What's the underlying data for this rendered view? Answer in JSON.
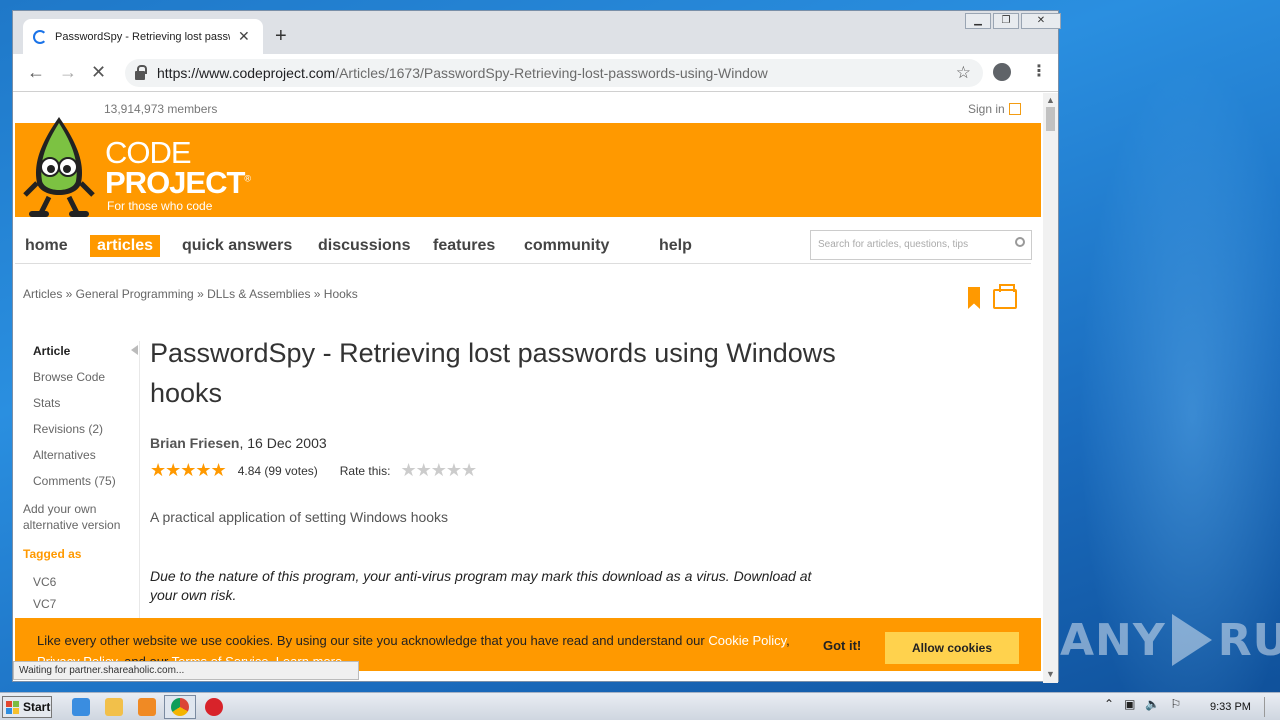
{
  "browser": {
    "tab_title": "PasswordSpy - Retrieving lost passw",
    "url_host": "https://www.codeproject.com",
    "url_path": "/Articles/1673/PasswordSpy-Retrieving-lost-passwords-using-Window",
    "status_text": "Waiting for partner.shareaholic.com..."
  },
  "header": {
    "members": "13,914,973 members",
    "signin": "Sign in",
    "logo_line1": "CODE",
    "logo_line2": "PROJECT",
    "logo_registered": "®",
    "tagline": "For those who code"
  },
  "nav": {
    "items": [
      "home",
      "articles",
      "quick answers",
      "discussions",
      "features",
      "community",
      "help"
    ],
    "active": "articles",
    "search_placeholder": "Search for articles, questions, tips"
  },
  "breadcrumb": "Articles » General Programming » DLLs & Assemblies » Hooks",
  "sidebar": {
    "items": [
      "Article",
      "Browse Code",
      "Stats",
      "Revisions (2)",
      "Alternatives",
      "Comments (75)"
    ],
    "add_version": "Add your own alternative version",
    "tagged_as": "Tagged as",
    "tags": [
      "VC6",
      "VC7"
    ]
  },
  "article": {
    "title": "PasswordSpy - Retrieving lost passwords using Windows hooks",
    "author": "Brian Friesen",
    "date": ", 16 Dec 2003",
    "rating_value": 4.84,
    "rating_text": "4.84 (99 votes)",
    "rate_label": "Rate this:",
    "summary": "A practical application of setting Windows hooks",
    "warning": "Due to the nature of this program, your anti-virus program may mark this download as a virus. Download at your own risk."
  },
  "cookie": {
    "text1": "Like every other website we use cookies. By using our site you acknowledge that you have read and understand our ",
    "link1": "Cookie Policy",
    "text2": ", ",
    "link2": "Privacy Policy",
    "text3": ", and our ",
    "link3": "Terms of Service",
    "text4": ". ",
    "link4": "Learn more",
    "gotit": "Got it!",
    "allow": "Allow cookies"
  },
  "taskbar": {
    "start": "Start",
    "clock": "9:33 PM"
  },
  "watermark": {
    "left": "ANY",
    "right": "RUN"
  },
  "colors": {
    "brand_orange": "#ff9900",
    "desktop_blue": "#1f78c8"
  },
  "icons": [
    "spinner-icon",
    "close-icon",
    "plus-icon",
    "back-arrow-icon",
    "forward-arrow-icon",
    "stop-icon",
    "lock-icon",
    "star-icon",
    "profile-icon",
    "kebab-menu-icon",
    "search-icon",
    "bookmark-icon",
    "print-icon",
    "windows-flag-icon",
    "ie-icon",
    "explorer-icon",
    "media-player-icon",
    "chrome-icon",
    "opera-icon"
  ]
}
